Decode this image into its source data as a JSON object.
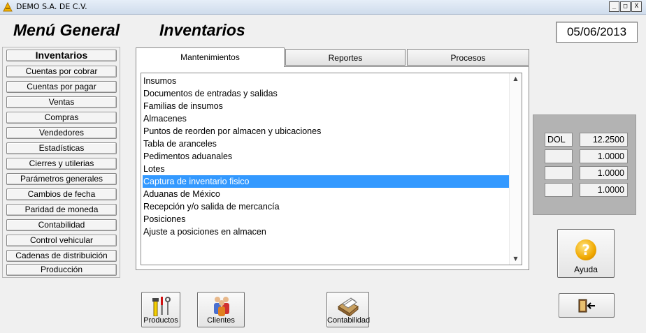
{
  "window": {
    "title": "DEMO  S.A. DE C.V.",
    "minimize": "_",
    "maximize": "□",
    "close": "X"
  },
  "header": {
    "menu_title": "Menú General",
    "section_title": "Inventarios",
    "date": "05/06/2013"
  },
  "sidebar": {
    "items": [
      {
        "label": "Inventarios",
        "active": true
      },
      {
        "label": "Cuentas por cobrar"
      },
      {
        "label": "Cuentas por pagar"
      },
      {
        "label": "Ventas"
      },
      {
        "label": "Compras"
      },
      {
        "label": "Vendedores"
      },
      {
        "label": "Estadísticas"
      },
      {
        "label": "Cierres y utilerias"
      },
      {
        "label": "Parámetros generales"
      },
      {
        "label": "Cambios de fecha"
      },
      {
        "label": "Paridad de moneda"
      },
      {
        "label": "Contabilidad"
      },
      {
        "label": "Control vehicular"
      },
      {
        "label": "Cadenas de distribuición"
      },
      {
        "label": "Producción"
      }
    ]
  },
  "tabs": [
    {
      "label": "Mantenimientos",
      "active": true
    },
    {
      "label": "Reportes"
    },
    {
      "label": "Procesos"
    }
  ],
  "list": {
    "selected_index": 9,
    "items": [
      "Insumos",
      "Documentos de entradas y salidas",
      "Familias de insumos",
      "Almacenes",
      "Puntos de reorden por almacen y ubicaciones",
      "Tabla de aranceles",
      "Pedimentos aduanales",
      "Lotes",
      "Captura de inventario fisico",
      "Aduanas de México",
      "Recepción y/o salida de mercancía",
      "Posiciones",
      "Ajuste a  posiciones en almacen"
    ]
  },
  "rates": [
    {
      "code": "DOL",
      "value": "12.2500"
    },
    {
      "code": "",
      "value": "1.0000"
    },
    {
      "code": "",
      "value": "1.0000"
    },
    {
      "code": "",
      "value": "1.0000"
    }
  ],
  "buttons": {
    "help": "Ayuda",
    "productos": "Productos",
    "clientes": "Clientes",
    "contabilidad": "Contabilidad"
  },
  "colors": {
    "selection": "#3399ff",
    "rate_panel": "#b3b3b3",
    "help_icon": "#f0a800"
  },
  "icons": {
    "help": "question-icon",
    "exit": "exit-door-icon",
    "productos": "tools-icon",
    "clientes": "people-icon",
    "contabilidad": "card-file-icon"
  }
}
